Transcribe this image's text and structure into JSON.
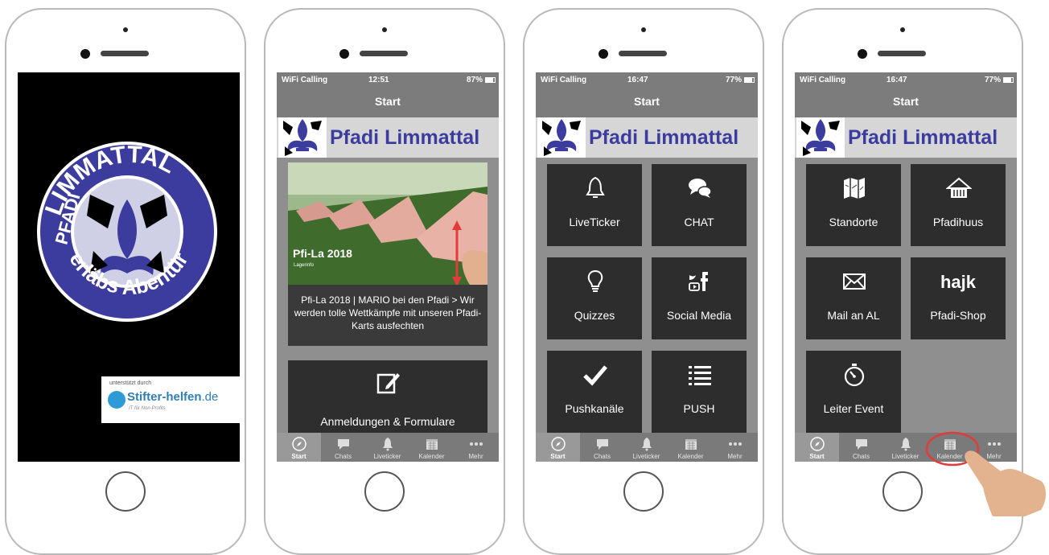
{
  "screen1": {
    "logo_top_text": "LIMMATTAL",
    "logo_left_text": "PFADI",
    "logo_bottom_text": "erläbs Abentür",
    "sponsor_small": "unterstützt durch",
    "sponsor_name": "Stifter-helfen",
    "sponsor_tld": ".de",
    "sponsor_tag": "IT für Non-Profits"
  },
  "screen2": {
    "status": {
      "carrier": "WiFi Calling",
      "time": "12:51",
      "right": "87%"
    },
    "nav_title": "Start",
    "banner_title": "Pfadi Limmattal",
    "news_overlay_title": "Pfi-La 2018",
    "news_overlay_sub": "Lagerinfo",
    "news_caption": "Pfi-La 2018 | MARIO bei den Pfadi > Wir werden tolle Wettkämpfe mit unseren Pfadi-Karts ausfechten",
    "form_tile_label": "Anmeldungen & Formulare"
  },
  "screen3": {
    "status": {
      "carrier": "WiFi Calling",
      "time": "16:47",
      "right": "77%"
    },
    "nav_title": "Start",
    "banner_title": "Pfadi Limmattal",
    "tiles": [
      {
        "label": "LiveTicker",
        "icon": "bell-icon"
      },
      {
        "label": "CHAT",
        "icon": "chat-bubbles-icon"
      },
      {
        "label": "Quizzes",
        "icon": "lightbulb-icon"
      },
      {
        "label": "Social Media",
        "icon": "social-media-icon"
      },
      {
        "label": "Pushkanäle",
        "icon": "checkmark-icon"
      },
      {
        "label": "PUSH",
        "icon": "list-icon"
      }
    ]
  },
  "screen4": {
    "status": {
      "carrier": "WiFi Calling",
      "time": "16:47",
      "right": "77%"
    },
    "nav_title": "Start",
    "banner_title": "Pfadi Limmattal",
    "tiles": [
      {
        "label": "Standorte",
        "icon": "map-icon"
      },
      {
        "label": "Pfadihuus",
        "icon": "house-icon"
      },
      {
        "label": "Mail an AL",
        "icon": "envelope-icon"
      },
      {
        "label": "Pfadi-Shop",
        "icon": "hajk-logo",
        "logo_text": "hajk"
      },
      {
        "label": "Leiter Event",
        "icon": "stopwatch-icon"
      }
    ]
  },
  "tabbar": [
    {
      "label": "Start",
      "icon": "compass-icon"
    },
    {
      "label": "Chats",
      "icon": "chat-icon"
    },
    {
      "label": "Liveticker",
      "icon": "bell-icon"
    },
    {
      "label": "Kalender",
      "icon": "calendar-icon"
    },
    {
      "label": "Mehr",
      "icon": "more-icon"
    }
  ],
  "colors": {
    "brand_blue": "#3b3c9e",
    "nav_gray": "#7c7c7c",
    "tile_dark": "#2d2d2d",
    "highlight_red": "#e23b3b"
  }
}
